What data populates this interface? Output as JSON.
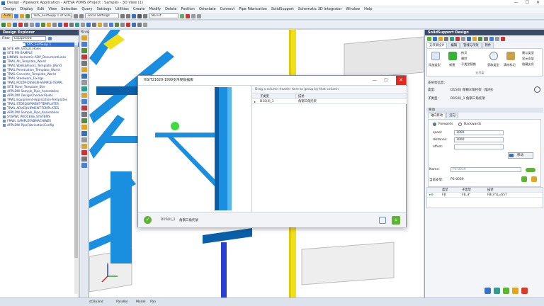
{
  "window": {
    "title": "Design - Pipework Application - AVEVA PDMS (Project : Sample) - 3D View (1)",
    "minimize": "—",
    "maximize": "☐",
    "close": "✕"
  },
  "menu": [
    "Design",
    "Display",
    "Edit",
    "View",
    "Selection",
    "Query",
    "Settings",
    "Utilities",
    "Create",
    "Modify",
    "Delete",
    "Position",
    "Orientate",
    "Connect",
    "Pipe Fabrication",
    "SolidSupport",
    "Schematic 3D Integrator",
    "Window",
    "Help"
  ],
  "toolbar": {
    "auto_label": "Auto",
    "element_combo": "SDS_SuitSupp 1 of SDS_Su",
    "settings_combo": "Local Settings",
    "list_combo": "No list"
  },
  "left_panel": {
    "title": "Design Explorer",
    "filter_label": "Filter",
    "filter_value": "Equipment",
    "selected_item": "SDS_SuitSupp 1",
    "items": [
      "SITE HM_Virtual_Holes",
      "SITE PSI-SAMPLE",
      "LINKWL Isometric-ADP_DocumentLinks",
      "TPWL All_Template_World",
      "TPWL Walls&Floors_Template_World",
      "TPWL Penetration_Template_World",
      "TPWL Concrete_Template_World",
      "TPWL Steelwork_Fixings",
      "TPWL ROOM-DESIGN-SAMPLE-TEMPL",
      "SITE Steel_Template_Site",
      "APPLDW Sample_Pipe_Assemblies",
      "APPLDW DesignChecker/Rules",
      "TPWL Equipment-Application-Templates",
      "TPWL STDEQUIPMENT-TEMPLATES",
      "TPWL ADVEQUIPMENT-TEMPLATES",
      "APPLDW Sample_Pipe_Assemblies",
      "SYSPWL PROCESS_SYSTEMS",
      "FMWL SAMPLEFABMACHINES",
      "APPLDW PipeFabricationConfig"
    ]
  },
  "navigator": {
    "title": "Navigator"
  },
  "dialog": {
    "title": "HG/T21629-1999支吊架数据库",
    "group_hint": "Drag a column header here to group by that column",
    "columns": [
      "子类型",
      "描述"
    ],
    "rows": [
      [
        "D15(II)_1",
        "角钢三角托架"
      ]
    ],
    "footer_type": "D15(II)_1",
    "footer_desc": "角钢三角托架"
  },
  "right_panel": {
    "title": "SolidSupport Design",
    "tabs": [
      "支吊架设计",
      "编辑",
      "管线与吊架",
      "附件"
    ],
    "ribbon": {
      "btn_insert": "添加类型",
      "btn_new": "新建",
      "btn_copy": "拷贝",
      "btn_delete": "删除",
      "btn_replace": "子类型替换",
      "btn_get": "获取类型",
      "btn_clear": "清除标记",
      "btn_a": "需认类型",
      "btn_b": "显示支架",
      "btn_c": "隐藏支吊",
      "group_label": "支吊架"
    },
    "info_heading": "支吊架信息:",
    "type_label": "类型:",
    "type_value": "D15(II) 角钢三角托架（墙/柱）",
    "subtype_label": "子类型:",
    "subtype_value": "D15(II)_1 角钢三角托架",
    "move_heading": "移动",
    "move_tabs": [
      "轴向移动",
      "沿向"
    ],
    "forwards": "Forwards",
    "backwards": "Backwards",
    "spool_label": "spool:",
    "spool_value": "1000",
    "distance_label": "distance:",
    "distance_value": "1000",
    "offset_label": "offset:",
    "offset_value": "",
    "move_button": "移动",
    "name_label": "Name:",
    "name_value": "PS-0039",
    "current_label": "当前支架:",
    "current_value": "PS-0039",
    "grid_columns": [
      "类型",
      "子类型",
      "描述"
    ],
    "grid_row": [
      "FB",
      "FB_3\"",
      "FB(3\")L=657"
    ]
  },
  "status": {
    "coord": "st2la3nd",
    "mode1": "Parallel",
    "mode2": "Model",
    "mode3": "Pan"
  },
  "colors": {
    "steel": "#1a8fe0",
    "steel_dark": "#0b5fa8",
    "pipe": "#f2df18",
    "pipe_blue": "#2b3fd1",
    "accent": "#3a4a66",
    "close_red": "#e3281e",
    "ok_green": "#5cb531"
  }
}
